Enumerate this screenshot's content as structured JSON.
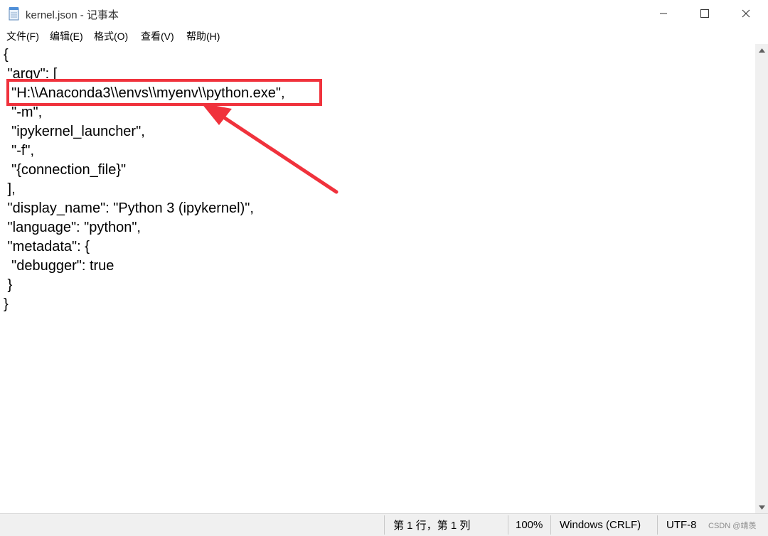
{
  "window": {
    "title": "kernel.json - 记事本",
    "controls": {
      "minimize": "─",
      "maximize": "☐",
      "close": "✕"
    }
  },
  "menu": [
    {
      "label": "文件(F)"
    },
    {
      "label": "编辑(E)"
    },
    {
      "label": "格式(O)"
    },
    {
      "label": "查看(V)"
    },
    {
      "label": "帮助(H)"
    }
  ],
  "editor": {
    "lines": [
      "{",
      " \"argv\": [",
      "  \"H:\\\\Anaconda3\\\\envs\\\\myenv\\\\python.exe\",",
      "  \"-m\",",
      "  \"ipykernel_launcher\",",
      "  \"-f\",",
      "  \"{connection_file}\"",
      " ],",
      " \"display_name\": \"Python 3 (ipykernel)\",",
      " \"language\": \"python\",",
      " \"metadata\": {",
      "  \"debugger\": true",
      " }",
      "}"
    ]
  },
  "status": {
    "position": "第 1 行，第 1 列",
    "zoom": "100%",
    "line_ending": "Windows (CRLF)",
    "encoding": "UTF-8"
  },
  "watermark": "CSDN @靖羡",
  "annotation": {
    "color": "#f0323c"
  }
}
